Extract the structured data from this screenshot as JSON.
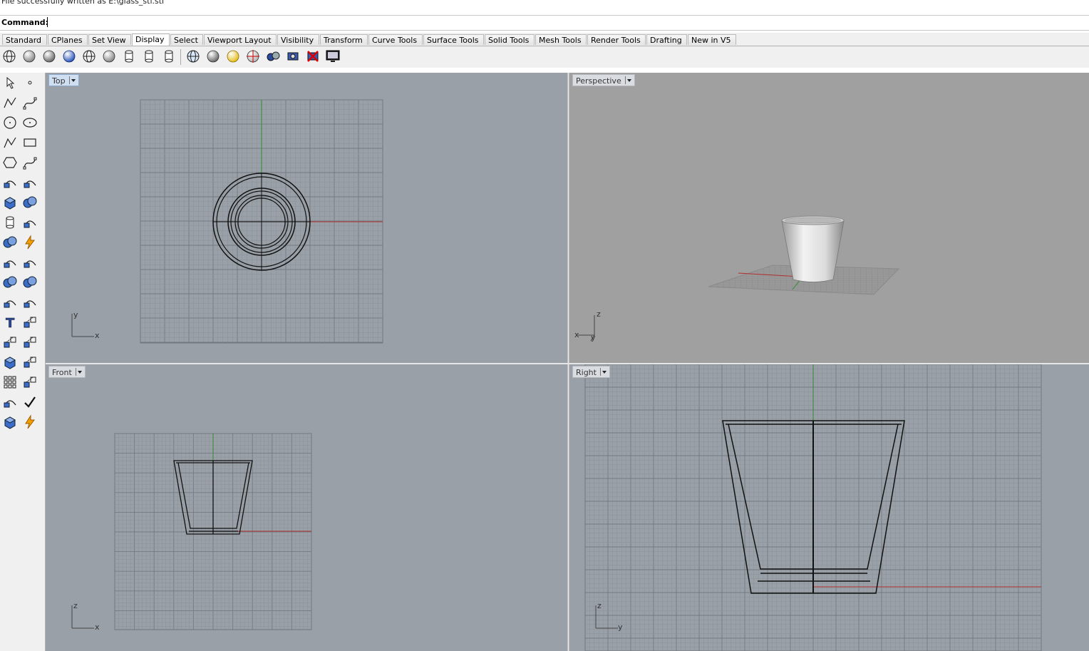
{
  "status": {
    "history_line": "File successfully written as E:\\glass_stl.stl"
  },
  "command": {
    "label": "Command:",
    "value": ""
  },
  "tabs": [
    {
      "label": "Standard"
    },
    {
      "label": "CPlanes"
    },
    {
      "label": "Set View"
    },
    {
      "label": "Display",
      "active": true
    },
    {
      "label": "Select"
    },
    {
      "label": "Viewport Layout"
    },
    {
      "label": "Visibility"
    },
    {
      "label": "Transform"
    },
    {
      "label": "Curve Tools"
    },
    {
      "label": "Surface Tools"
    },
    {
      "label": "Solid Tools"
    },
    {
      "label": "Mesh Tools"
    },
    {
      "label": "Render Tools"
    },
    {
      "label": "Drafting"
    },
    {
      "label": "New in V5"
    }
  ],
  "display_toolbar": [
    {
      "icon": "wireframe-globe-icon"
    },
    {
      "icon": "shaded-sphere-icon"
    },
    {
      "icon": "rendered-sphere-icon"
    },
    {
      "icon": "blue-sphere-icon"
    },
    {
      "icon": "ghosted-globe-icon"
    },
    {
      "icon": "xray-sphere-icon"
    },
    {
      "icon": "technical-cylinder-icon"
    },
    {
      "icon": "artistic-cylinder-icon"
    },
    {
      "icon": "pen-cylinder-icon"
    },
    {
      "icon": "world-globe-icon"
    },
    {
      "icon": "gray-sphere-icon"
    },
    {
      "icon": "light-bulb-icon"
    },
    {
      "icon": "target-sphere-icon"
    },
    {
      "icon": "spheres-pair-icon"
    },
    {
      "icon": "camera-capture-icon"
    },
    {
      "icon": "delete-capture-icon"
    },
    {
      "icon": "monitor-icon"
    }
  ],
  "left_toolbar": [
    [
      "select-arrow-icon",
      "point-icon"
    ],
    [
      "polyline-icon",
      "curve-icon"
    ],
    [
      "circle-icon",
      "ellipse-icon"
    ],
    [
      "polygon-icon",
      "rectangle-icon"
    ],
    [
      "hexagon-icon",
      "fillet-curve-icon"
    ],
    [
      "surface-corner-icon",
      "surface-revolve-icon"
    ],
    [
      "box-solid-icon",
      "boolean-union-icon"
    ],
    [
      "cylinder-icon",
      "mesh-plane-icon"
    ],
    [
      "gear-explode-icon",
      "lightning-icon"
    ],
    [
      "trim-icon",
      "split-icon"
    ],
    [
      "join-icon",
      "group-icon"
    ],
    [
      "fillet-icon",
      "blend-icon"
    ],
    [
      "text-icon",
      "scale-icon"
    ],
    [
      "array-icon",
      "mirror-icon"
    ],
    [
      "box-view-icon",
      "dimension-icon"
    ],
    [
      "grid-array-icon",
      "align-icon"
    ],
    [
      "analyze-icon",
      "check-icon"
    ],
    [
      "render-icon",
      "paint-icon"
    ]
  ],
  "viewports": {
    "top": {
      "title": "Top",
      "active": true,
      "axis_a": "y",
      "axis_b": "x"
    },
    "perspective": {
      "title": "Perspective",
      "axis_a": "z",
      "axis_b": "x",
      "axis_c": "y"
    },
    "front": {
      "title": "Front",
      "axis_a": "z",
      "axis_b": "x"
    },
    "right": {
      "title": "Right",
      "axis_a": "z",
      "axis_b": "y"
    }
  },
  "colors": {
    "viewport_bg": "#9aa0a7",
    "perspective_bg": "#a0a0a0",
    "grid_minor": "#8c9197",
    "grid_major": "#747a81",
    "x_axis": "#b03030",
    "y_axis": "#2c8c2c",
    "ui_bg": "#f0f0f0"
  }
}
